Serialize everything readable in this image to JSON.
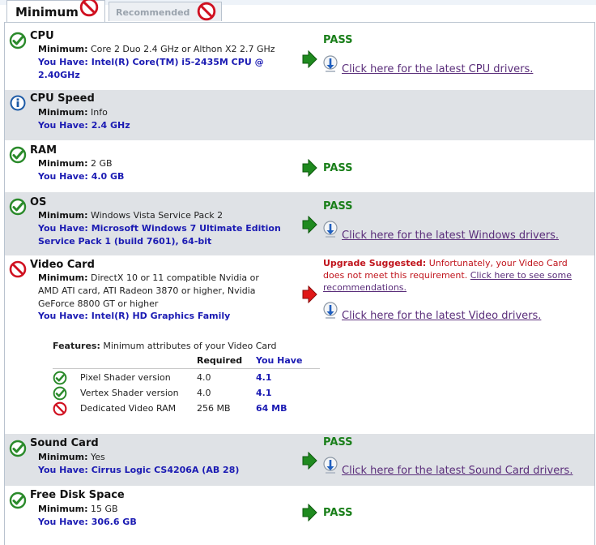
{
  "tabs": {
    "minimum": "Minimum",
    "recommended": "Recommended"
  },
  "labels": {
    "minimum": "Minimum:",
    "you_have": "You Have:",
    "pass": "PASS"
  },
  "sections": {
    "cpu": {
      "title": "CPU",
      "minimum": "Core 2 Duo 2.4 GHz or Althon X2 2.7 GHz",
      "have_line1": "Intel(R) Core(TM) i5-2435M CPU @",
      "have_line2": "2.40GHz",
      "link": "Click here for the latest CPU drivers."
    },
    "cpu_speed": {
      "title": "CPU Speed",
      "minimum": "Info",
      "have": "2.4 GHz"
    },
    "ram": {
      "title": "RAM",
      "minimum": "2 GB",
      "have": "4.0 GB"
    },
    "os": {
      "title": "OS",
      "minimum": "Windows Vista Service Pack 2",
      "have_line1": "Microsoft Windows 7 Ultimate Edition",
      "have_line2": "Service Pack 1 (build 7601), 64-bit",
      "link": "Click here for the latest Windows drivers."
    },
    "video": {
      "title": "Video Card",
      "minimum_line1": "DirectX 10 or 11 compatible Nvidia or",
      "minimum_line2": "AMD ATI card, ATI Radeon 3870 or higher, Nvidia",
      "minimum_line3": "GeForce 8800 GT or higher",
      "have": "Intel(R) HD Graphics Family",
      "upgrade_label": "Upgrade Suggested:",
      "upgrade_text_1": "Unfortunately, your Video Card",
      "upgrade_text_2": "does not meet this requirement.",
      "upgrade_link_1": "Click here to see some",
      "upgrade_link_2": "recommendations.",
      "link": "Click here for the latest Video drivers.",
      "features_label": "Features:",
      "features_desc": "Minimum attributes of your Video Card",
      "col_required": "Required",
      "col_you_have": "You Have",
      "features": [
        {
          "name": "Pixel Shader version",
          "required": "4.0",
          "have": "4.1",
          "status": "pass"
        },
        {
          "name": "Vertex Shader version",
          "required": "4.0",
          "have": "4.1",
          "status": "pass"
        },
        {
          "name": "Dedicated Video RAM",
          "required": "256 MB",
          "have": "64 MB",
          "status": "fail"
        }
      ]
    },
    "sound": {
      "title": "Sound Card",
      "minimum": "Yes",
      "have": "Cirrus Logic CS4206A (AB 28)",
      "link": "Click here for the latest Sound Card drivers."
    },
    "disk": {
      "title": "Free Disk Space",
      "minimum": "15 GB",
      "have": "306.6 GB"
    }
  },
  "icons": {
    "pass": "check-circle-icon",
    "fail": "no-entry-icon",
    "info": "info-icon",
    "arrow_pass": "green-arrow-icon",
    "arrow_fail": "red-arrow-icon",
    "download": "download-icon"
  },
  "colors": {
    "pass_green": "#1a7f1a",
    "fail_red": "#c0141c",
    "have_blue": "#1b1bb3",
    "link_purple": "#5a2d7a",
    "row_shade": "#dfe2e6"
  }
}
